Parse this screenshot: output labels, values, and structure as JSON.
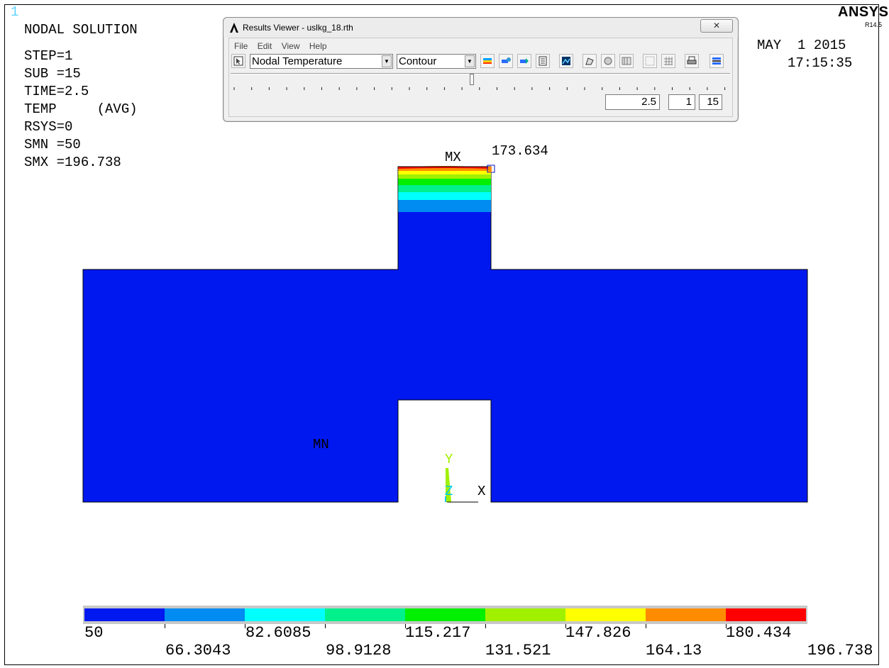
{
  "window_number": "1",
  "solution_title": "NODAL SOLUTION",
  "info_lines": [
    "STEP=1",
    "SUB =15",
    "TIME=2.5",
    "TEMP     (AVG)",
    "RSYS=0",
    "SMN =50",
    "SMX =196.738"
  ],
  "brand": {
    "name": "ANSYS",
    "release": "R14.5"
  },
  "date": "MAY  1 2015",
  "time": "17:15:35",
  "results_viewer": {
    "title": "Results Viewer -  uslkg_18.rth",
    "close_glyph": "✕",
    "menu": [
      "File",
      "Edit",
      "View",
      "Help"
    ],
    "item_select": "Nodal Temperature",
    "display_select": "Contour",
    "time_value": "2.5",
    "step_value": "1",
    "substep_value": "15",
    "icons": [
      "pointer-icon",
      "contour-plot-icon",
      "vector-plot-icon",
      "animate-icon",
      "list-icon",
      "image-capture-icon",
      "query-icon",
      "graph-icon",
      "element-grid-icon",
      "node-grid-icon",
      "mesh-icon",
      "print-icon",
      "options-icon"
    ]
  },
  "plot": {
    "max_label": "MX",
    "max_value": "173.634",
    "min_label": "MN",
    "axis_y": "Y",
    "axis_z": "Z",
    "axis_x": "X"
  },
  "legend": {
    "colors": [
      "#0018f0",
      "#008cf0",
      "#00ffff",
      "#00f08c",
      "#00f000",
      "#a0f000",
      "#ffff00",
      "#ff8c00",
      "#ff0000"
    ],
    "values_top": [
      "50",
      "82.6085",
      "115.217",
      "147.826",
      "180.434"
    ],
    "values_bottom": [
      "66.3043",
      "98.9128",
      "131.521",
      "164.13",
      "196.738"
    ]
  },
  "model_fill_color": "#0018f0"
}
